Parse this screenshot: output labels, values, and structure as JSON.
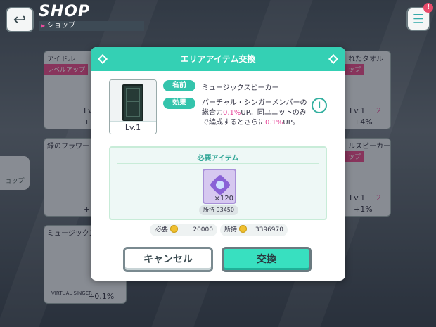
{
  "header": {
    "title": "SHOP",
    "subtitle": "ショップ",
    "menu_badge": "!"
  },
  "background": {
    "cards": [
      {
        "title": "アイドル",
        "tag": "レベルアップ",
        "level": "Lv",
        "bonus": "+0"
      },
      {
        "title": "緑のフラワー",
        "bonus": "+0"
      },
      {
        "title": "ミュージックス",
        "footer": "VIRTUAL SINGER",
        "bonus": "+0.1%"
      },
      {
        "title": "れたタオル",
        "tag": "ップ",
        "level_from": "Lv.1",
        "level_to": "2",
        "bonus": "+4%"
      },
      {
        "title": "ルスピーカー",
        "tag": "ップ",
        "level_from": "Lv.1",
        "level_to": "2",
        "bonus": "+1%"
      }
    ],
    "side_label": "ョップ"
  },
  "modal": {
    "title": "エリアアイテム交換",
    "item": {
      "level": "Lv.1",
      "name_label": "名前",
      "name": "ミュージックスピーカー",
      "effect_label": "効果",
      "effect_1": "バーチャル・シンガーメンバーの総合力",
      "effect_1_highlight": "0.1%",
      "effect_2": "UP。同ユニットのみで編成するとさらに",
      "effect_2_highlight": "0.1%",
      "effect_3": "UP。"
    },
    "required": {
      "title": "必要アイテム",
      "quantity": "×120",
      "owned": "所持 93450"
    },
    "cost": {
      "need_label": "必要",
      "need_value": "20000",
      "own_label": "所持",
      "own_value": "3396970"
    },
    "buttons": {
      "cancel": "キャンセル",
      "exchange": "交換"
    }
  },
  "colors": {
    "accent": "#34d0b4",
    "highlight": "#e84b9c"
  }
}
